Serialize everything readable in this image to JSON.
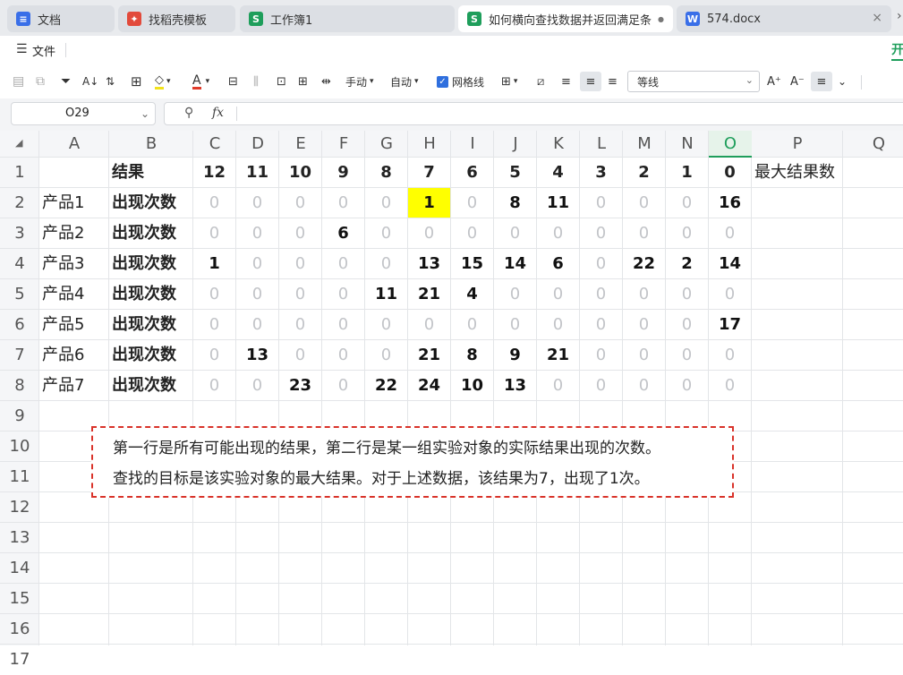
{
  "tabs": [
    {
      "label": "文档",
      "icon": "doc-icon",
      "icon_char": "≡",
      "color": "#3a6fe8",
      "active": false
    },
    {
      "label": "找稻壳模板",
      "icon": "docer-icon",
      "icon_char": "✦",
      "color": "#e24a3b",
      "active": false
    },
    {
      "label": "工作簿1",
      "icon": "sheet-icon",
      "icon_char": "S",
      "color": "#1e9e5b",
      "active": false
    },
    {
      "label": "如何横向查找数据并返回满足条件的",
      "icon": "sheet-icon",
      "icon_char": "S",
      "color": "#1e9e5b",
      "active": true
    },
    {
      "label": "574.docx",
      "icon": "word-icon",
      "icon_char": "W",
      "color": "#3a6fe8",
      "active": false
    }
  ],
  "menu": {
    "file_label": "文件",
    "right_label": "开"
  },
  "toolbar": {
    "manual_label": "手动",
    "auto_label": "自动",
    "gridlines_label": "网格线",
    "gridlines_checked": true,
    "font_name": "等线"
  },
  "formula": {
    "cell_ref": "O29",
    "fx_label": "fx",
    "value": ""
  },
  "columns": [
    "A",
    "B",
    "C",
    "D",
    "E",
    "F",
    "G",
    "H",
    "I",
    "J",
    "K",
    "L",
    "M",
    "N",
    "O",
    "P",
    "Q"
  ],
  "rows": [
    "1",
    "2",
    "3",
    "4",
    "5",
    "6",
    "7",
    "8",
    "9",
    "10",
    "11",
    "12",
    "13",
    "14",
    "15",
    "16",
    "17"
  ],
  "sheet": {
    "header_row": {
      "b": "结果",
      "values": [
        "12",
        "11",
        "10",
        "9",
        "8",
        "7",
        "6",
        "5",
        "4",
        "3",
        "2",
        "1",
        "0"
      ],
      "p": "最大结果数"
    },
    "products": [
      {
        "name": "产品1",
        "label": "出现次数",
        "values": [
          "0",
          "0",
          "0",
          "0",
          "0",
          "1",
          "0",
          "8",
          "11",
          "0",
          "0",
          "0",
          "16"
        ]
      },
      {
        "name": "产品2",
        "label": "出现次数",
        "values": [
          "0",
          "0",
          "0",
          "6",
          "0",
          "0",
          "0",
          "0",
          "0",
          "0",
          "0",
          "0",
          "0"
        ]
      },
      {
        "name": "产品3",
        "label": "出现次数",
        "values": [
          "1",
          "0",
          "0",
          "0",
          "0",
          "13",
          "15",
          "14",
          "6",
          "0",
          "22",
          "2",
          "14"
        ]
      },
      {
        "name": "产品4",
        "label": "出现次数",
        "values": [
          "0",
          "0",
          "0",
          "0",
          "11",
          "21",
          "4",
          "0",
          "0",
          "0",
          "0",
          "0",
          "0"
        ]
      },
      {
        "name": "产品5",
        "label": "出现次数",
        "values": [
          "0",
          "0",
          "0",
          "0",
          "0",
          "0",
          "0",
          "0",
          "0",
          "0",
          "0",
          "0",
          "17"
        ]
      },
      {
        "name": "产品6",
        "label": "出现次数",
        "values": [
          "0",
          "13",
          "0",
          "0",
          "0",
          "21",
          "8",
          "9",
          "21",
          "0",
          "0",
          "0",
          "0"
        ]
      },
      {
        "name": "产品7",
        "label": "出现次数",
        "values": [
          "0",
          "0",
          "23",
          "0",
          "22",
          "24",
          "10",
          "13",
          "0",
          "0",
          "0",
          "0",
          "0"
        ]
      }
    ],
    "highlight_color": "#ffff00",
    "note_lines": [
      "第一行是所有可能出现的结果，第二行是某一组实验对象的实际结果出现的次数。",
      "查找的目标是该实验对象的最大结果。对于上述数据，该结果为7，出现了1次。"
    ]
  }
}
